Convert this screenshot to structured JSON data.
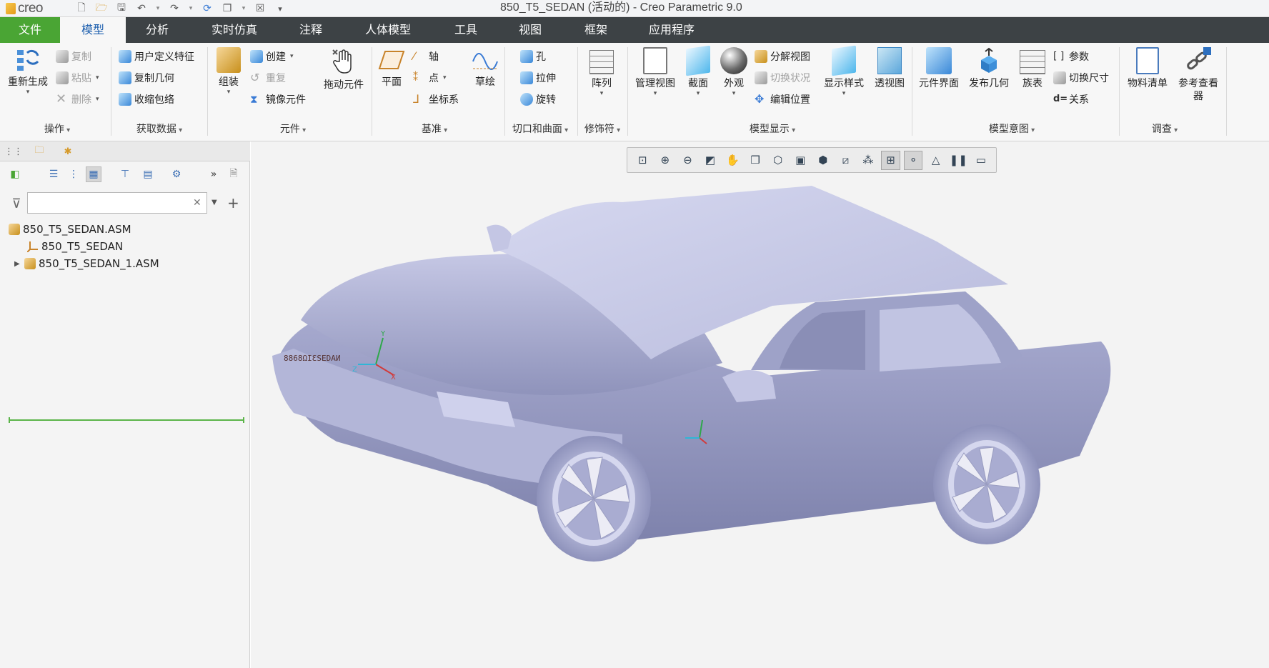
{
  "app": {
    "logo_text": "creo",
    "window_title": "850_T5_SEDAN (活动的) - Creo Parametric 9.0"
  },
  "menu_tabs": [
    {
      "label": "文件"
    },
    {
      "label": "模型"
    },
    {
      "label": "分析"
    },
    {
      "label": "实时仿真"
    },
    {
      "label": "注释"
    },
    {
      "label": "人体模型"
    },
    {
      "label": "工具"
    },
    {
      "label": "视图"
    },
    {
      "label": "框架"
    },
    {
      "label": "应用程序"
    }
  ],
  "ribbon": {
    "groups": [
      {
        "label": "操作"
      },
      {
        "label": "获取数据"
      },
      {
        "label": "元件"
      },
      {
        "label": "基准"
      },
      {
        "label": "切口和曲面"
      },
      {
        "label": "修饰符"
      },
      {
        "label": "模型显示"
      },
      {
        "label": "模型意图"
      },
      {
        "label": "调查"
      }
    ],
    "operations": {
      "regenerate": "重新生成",
      "copy": "复制",
      "paste": "粘贴",
      "delete": "删除"
    },
    "get_data": {
      "udf": "用户定义特征",
      "copy_geom": "复制几何",
      "shrinkwrap": "收缩包络"
    },
    "component": {
      "assemble": "组装",
      "create": "创建",
      "repeat": "重复",
      "mirror": "镜像元件",
      "drag": "拖动元件"
    },
    "datum": {
      "plane": "平面",
      "axis": "轴",
      "point": "点",
      "csys": "坐标系",
      "sketch": "草绘"
    },
    "cut_surface": {
      "hole": "孔",
      "extrude": "拉伸",
      "revolve": "旋转"
    },
    "modifiers": {
      "pattern": "阵列"
    },
    "model_display": {
      "manage_views": "管理视图",
      "section": "截面",
      "appearance": "外观",
      "explode_view": "分解视图",
      "toggle_status": "切换状况",
      "edit_position": "编辑位置",
      "display_style": "显示样式",
      "perspective": "透视图"
    },
    "model_intent": {
      "component_interface": "元件界面",
      "publish_geom": "发布几何",
      "family_table": "族表",
      "parameters": "参数",
      "switch_dims": "切换尺寸",
      "relations": "关系"
    },
    "investigate": {
      "bom": "物料清单",
      "ref_viewer_line1": "参考查看",
      "ref_viewer_line2": "器"
    }
  },
  "model_tree": {
    "search": {
      "value": "",
      "placeholder": ""
    },
    "items": [
      {
        "label": "850_T5_SEDAN.ASM"
      },
      {
        "label": "850_T5_SEDAN"
      },
      {
        "label": "850_T5_SEDAN_1.ASM"
      }
    ]
  },
  "viewport": {
    "datum_labels": "8868ΩIƐSEDAИ",
    "csys_labels": {
      "x": "X",
      "y": "Y",
      "z": "Z"
    },
    "model_color": "#b6b9d9"
  }
}
